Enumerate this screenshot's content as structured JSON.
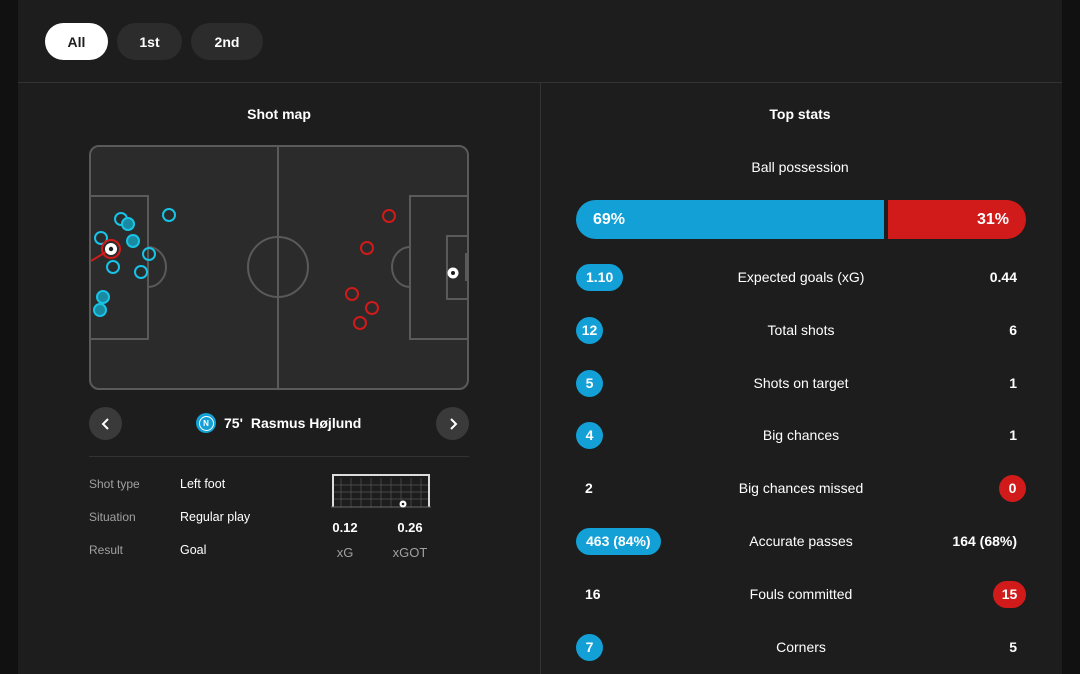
{
  "tabs": [
    {
      "label": "All",
      "active": true
    },
    {
      "label": "1st",
      "active": false
    },
    {
      "label": "2nd",
      "active": false
    }
  ],
  "shot_map": {
    "title": "Shot map",
    "selected_shot": {
      "minute": "75'",
      "player": "Rasmus Højlund",
      "club_badge_letter": "N",
      "details": [
        {
          "label": "Shot type",
          "value": "Left foot"
        },
        {
          "label": "Situation",
          "value": "Regular play"
        },
        {
          "label": "Result",
          "value": "Goal"
        }
      ],
      "xg_value": "0.12",
      "xg_label": "xG",
      "xgot_value": "0.26",
      "xgot_label": "xGOT"
    },
    "icons": {
      "prev": "chevron-left-icon",
      "next": "chevron-right-icon"
    },
    "colors": {
      "home": "#12a0d7",
      "away": "#d11a1a"
    }
  },
  "top_stats": {
    "title": "Top stats",
    "possession": {
      "label": "Ball possession",
      "home": "69%",
      "away": "31%",
      "home_value": 69,
      "away_value": 31
    },
    "rows": [
      {
        "label": "Expected goals (xG)",
        "home": "1.10",
        "away": "0.44",
        "highlight": "home"
      },
      {
        "label": "Total shots",
        "home": "12",
        "away": "6",
        "highlight": "home"
      },
      {
        "label": "Shots on target",
        "home": "5",
        "away": "1",
        "highlight": "home"
      },
      {
        "label": "Big chances",
        "home": "4",
        "away": "1",
        "highlight": "home"
      },
      {
        "label": "Big chances missed",
        "home": "2",
        "away": "0",
        "highlight": "away"
      },
      {
        "label": "Accurate passes",
        "home": "463 (84%)",
        "away": "164 (68%)",
        "highlight": "home"
      },
      {
        "label": "Fouls committed",
        "home": "16",
        "away": "15",
        "highlight": "away"
      },
      {
        "label": "Corners",
        "home": "7",
        "away": "5",
        "highlight": "home"
      }
    ]
  }
}
